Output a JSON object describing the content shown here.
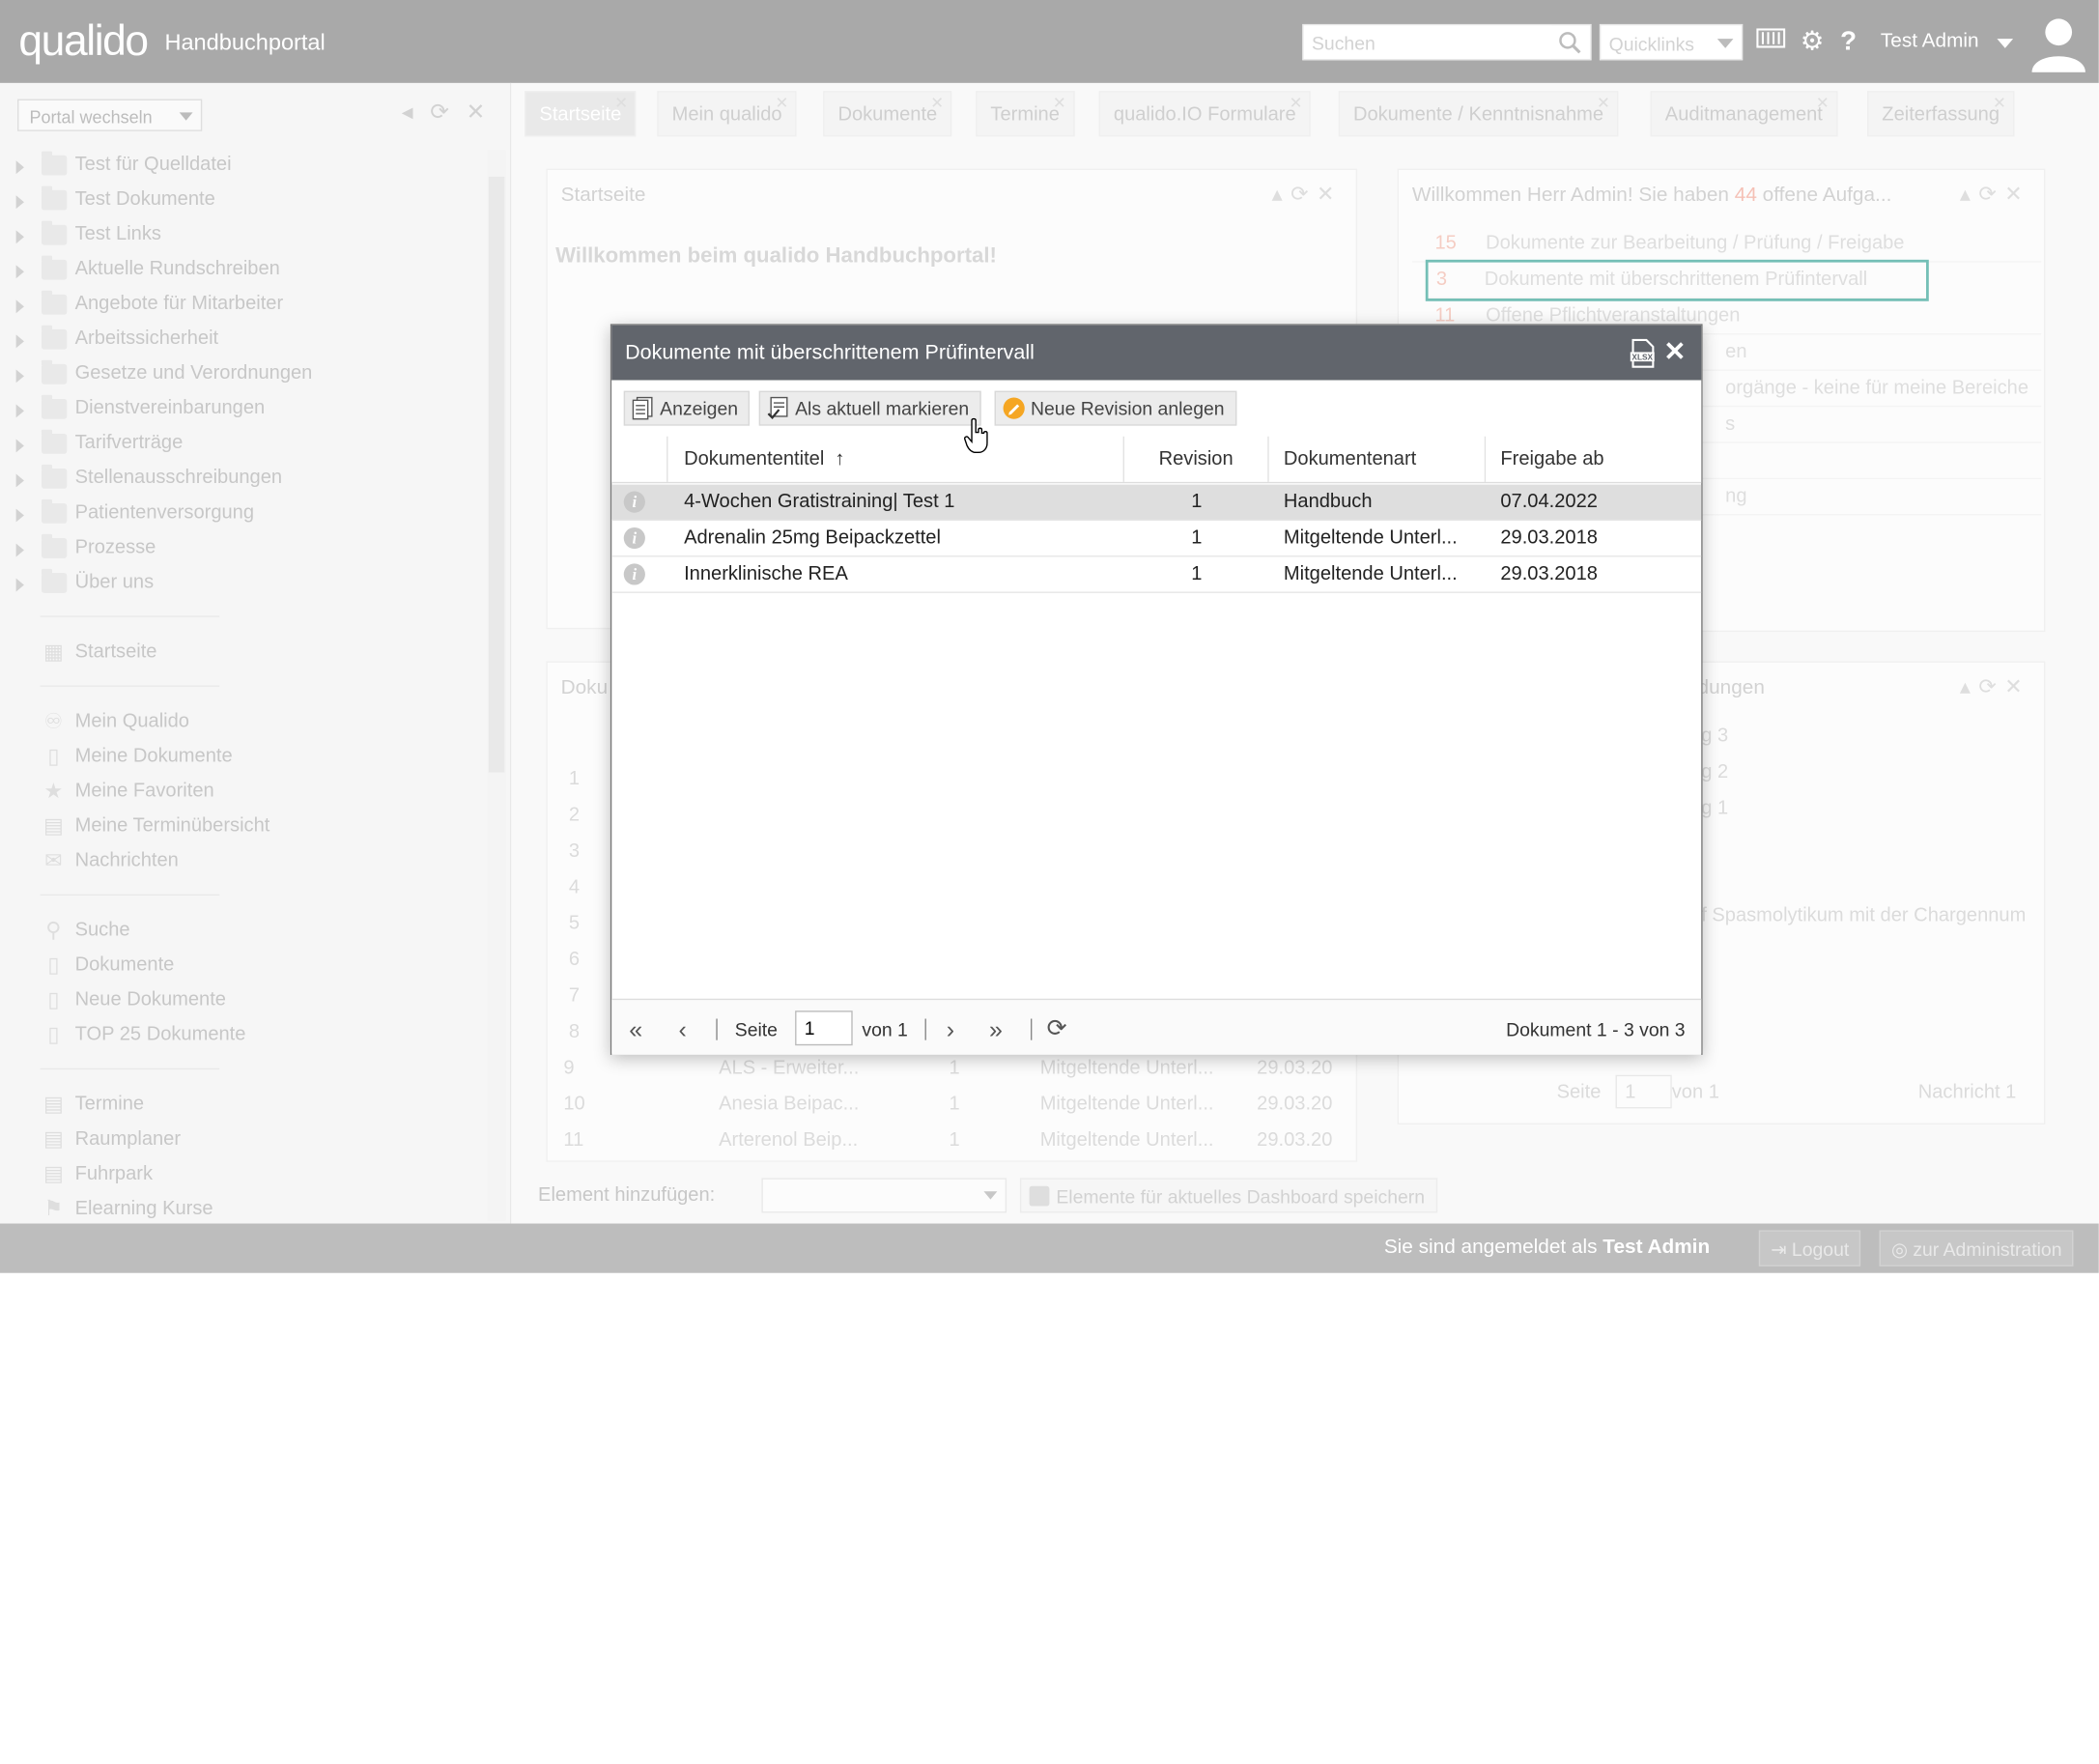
{
  "header": {
    "logo": "qualido",
    "portal_title": "Handbuchportal",
    "search_placeholder": "Suchen",
    "quicklinks": "Quicklinks",
    "user_name": "Test Admin"
  },
  "leftpanel": {
    "portal_switch": "Portal wechseln",
    "folders": [
      "Test für Quelldatei",
      "Test Dokumente",
      "Test Links",
      "Aktuelle Rundschreiben",
      "Angebote für Mitarbeiter",
      "Arbeitssicherheit",
      "Gesetze und Verordnungen",
      "Dienstvereinbarungen",
      "Tarifverträge",
      "Stellenausschreibungen",
      "Patientenversorgung",
      "Prozesse",
      "Über uns"
    ],
    "nav": {
      "startseite": "Startseite",
      "mein_qualido": "Mein Qualido",
      "meine_dokumente": "Meine Dokumente",
      "meine_favoriten": "Meine Favoriten",
      "meine_termin": "Meine Terminübersicht",
      "nachrichten": "Nachrichten",
      "suche": "Suche",
      "dokumente": "Dokumente",
      "neue_dokumente": "Neue Dokumente",
      "top25": "TOP 25 Dokumente",
      "termine": "Termine",
      "raumplaner": "Raumplaner",
      "fuhrpark": "Fuhrpark",
      "elearning": "Elearning Kurse"
    }
  },
  "tabs": [
    "Startseite",
    "Mein qualido",
    "Dokumente",
    "Termine",
    "qualido.IO Formulare",
    "Dokumente / Kenntnisnahme",
    "Auditmanagement",
    "Zeiterfassung"
  ],
  "widgets": {
    "start_title": "Startseite",
    "start_welcome": "Willkommen beim qualido Handbuchportal!",
    "tasks_title_pre": "Willkommen Herr Admin! Sie haben ",
    "tasks_count": "44",
    "tasks_title_post": " offene Aufga...",
    "tasks": [
      {
        "count": "15",
        "text": "Dokumente zur Bearbeitung / Prüfung / Freigabe"
      },
      {
        "count": "3",
        "text": "Dokumente mit überschrittenem Prüfintervall"
      },
      {
        "count": "11",
        "text": "Offene Pflichtveranstaltungen"
      }
    ],
    "tasks_partial": [
      "en",
      "orgänge - keine für meine Bereiche",
      "s",
      "ng"
    ],
    "doc_title_partial": "Doku",
    "news_title_partial": "ldungen",
    "news_partial": [
      "g 3",
      "g 2",
      "g 1",
      "f Spasmolytikum mit der Chargennum"
    ],
    "bg_rows": [
      {
        "n": "9",
        "title": "ALS - Erweiter...",
        "rev": "1",
        "art": "Mitgeltende Unterl...",
        "date": "29.03.20"
      },
      {
        "n": "10",
        "title": "Anesia Beipac...",
        "rev": "1",
        "art": "Mitgeltende Unterl...",
        "date": "29.03.20"
      },
      {
        "n": "11",
        "title": "Arterenol Beip...",
        "rev": "1",
        "art": "Mitgeltende Unterl...",
        "date": "29.03.20"
      }
    ],
    "bg_row_numbers": [
      "1",
      "2",
      "3",
      "4",
      "5",
      "6",
      "7",
      "8"
    ],
    "news_pager": {
      "seite": "Seite",
      "page": "1",
      "of": "von 1",
      "info": "Nachricht 1"
    }
  },
  "footer": {
    "add_label": "Element hinzufügen:",
    "save_label": "Elemente für aktuelles Dashboard speichern",
    "logged_in_pre": "Sie sind angemeldet als ",
    "logged_in_user": "Test Admin",
    "logout": "Logout",
    "admin": "zur Administration"
  },
  "dialog": {
    "title": "Dokumente mit überschrittenem Prüfintervall",
    "toolbar": {
      "show": "Anzeigen",
      "mark_current": "Als aktuell markieren",
      "new_revision": "Neue Revision anlegen"
    },
    "columns": [
      "Dokumententitel",
      "Revision",
      "Dokumentenart",
      "Freigabe ab"
    ],
    "rows": [
      {
        "title": "4-Wochen Gratistraining| Test 1",
        "revision": "1",
        "art": "Handbuch",
        "date": "07.04.2022"
      },
      {
        "title": "Adrenalin 25mg Beipackzettel",
        "revision": "1",
        "art": "Mitgeltende Unterl...",
        "date": "29.03.2018"
      },
      {
        "title": "Innerklinische REA",
        "revision": "1",
        "art": "Mitgeltende Unterl...",
        "date": "29.03.2018"
      }
    ],
    "pager": {
      "seite": "Seite",
      "page": "1",
      "of": "von 1",
      "info": "Dokument 1 - 3 von 3"
    }
  },
  "colors": {
    "topbar": "#7c7c7c",
    "dialog_header": "#61656c",
    "highlight": "#2a9d8f",
    "selected_row": "#dedede",
    "count_accent": "#f08f7a",
    "revision_icon": "#f5a623"
  }
}
